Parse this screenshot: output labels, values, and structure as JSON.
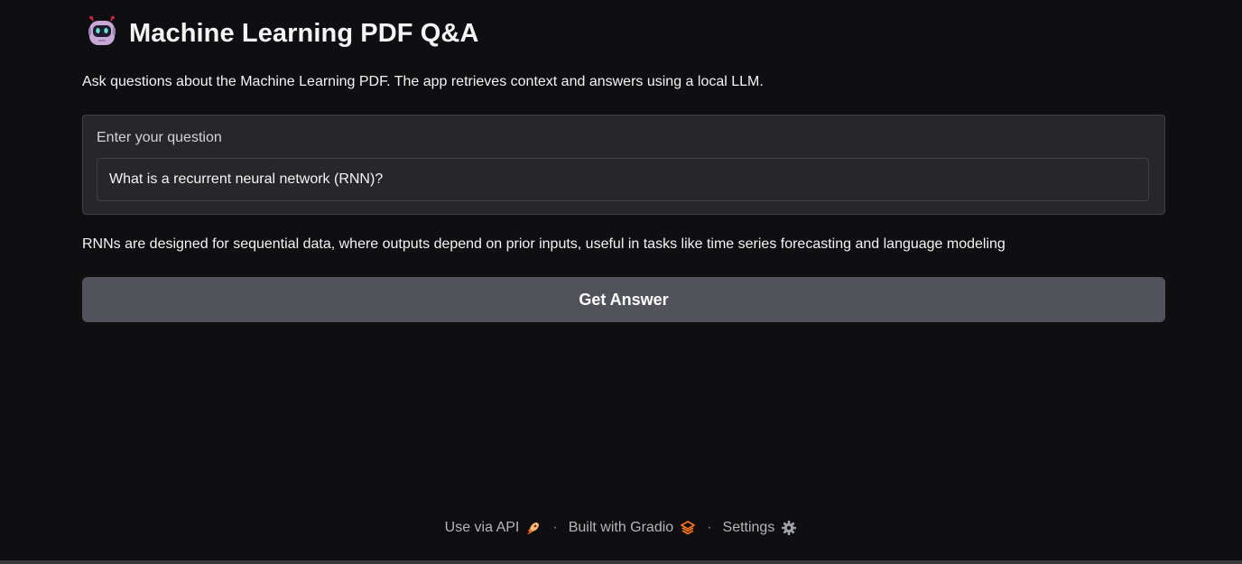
{
  "header": {
    "icon": "robot-icon",
    "title": "Machine Learning PDF Q&A"
  },
  "subtitle": "Ask questions about the Machine Learning PDF. The app retrieves context and answers using a local LLM.",
  "question": {
    "label": "Enter your question",
    "value": "What is a recurrent neural network (RNN)?"
  },
  "answer": "RNNs are designed for sequential data, where outputs depend on prior inputs, useful in tasks like time series forecasting and language modeling",
  "actions": {
    "submit_label": "Get Answer"
  },
  "footer": {
    "api_label": "Use via API",
    "api_icon": "rocket-icon",
    "separator": "·",
    "gradio_label": "Built with Gradio",
    "gradio_icon": "gradio-logo-icon",
    "settings_label": "Settings",
    "settings_icon": "gear-icon"
  },
  "colors": {
    "background": "#0f0f11",
    "panel": "#27272a",
    "border": "#3f3f46",
    "button": "#52525b",
    "text": "#f4f4f5",
    "footer_text": "#b4b4bb",
    "accent_orange": "#f97316"
  }
}
